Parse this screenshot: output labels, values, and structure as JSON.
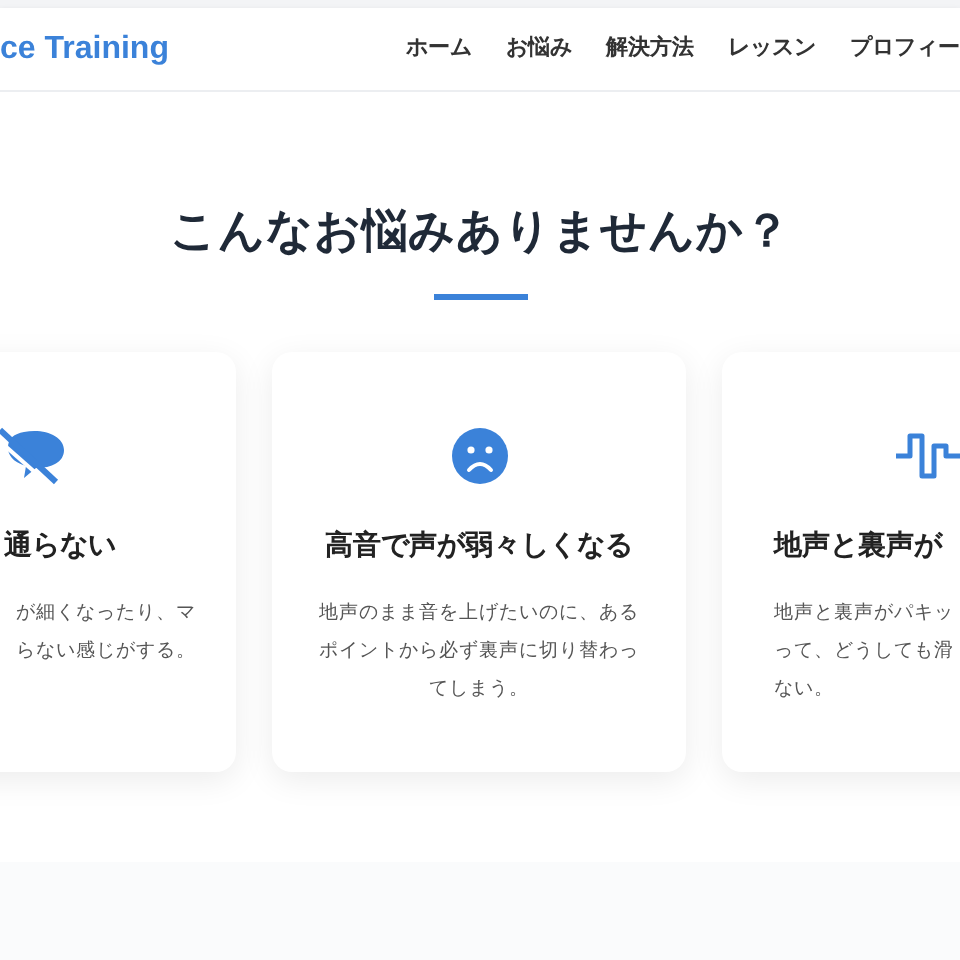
{
  "header": {
    "logo": "ce Training",
    "nav": [
      {
        "label": "ホーム"
      },
      {
        "label": "お悩み"
      },
      {
        "label": "解決方法"
      },
      {
        "label": "レッスン"
      },
      {
        "label": "プロフィー"
      }
    ]
  },
  "section": {
    "title": "こんなお悩みありませんか？",
    "cards": [
      {
        "title": "通らない",
        "lines": [
          "が細くなったり、マ",
          "らない感じがする。"
        ]
      },
      {
        "title": "高音で声が弱々しくなる",
        "lines": [
          "地声のまま音を上げたいのに、ある",
          "ポイントから必ず裏声に切り替わっ",
          "てしまう。"
        ]
      },
      {
        "title": "地声と裏声が",
        "lines": [
          "地声と裏声がパキッ",
          "って、どうしても滑",
          "ない。"
        ]
      }
    ]
  }
}
